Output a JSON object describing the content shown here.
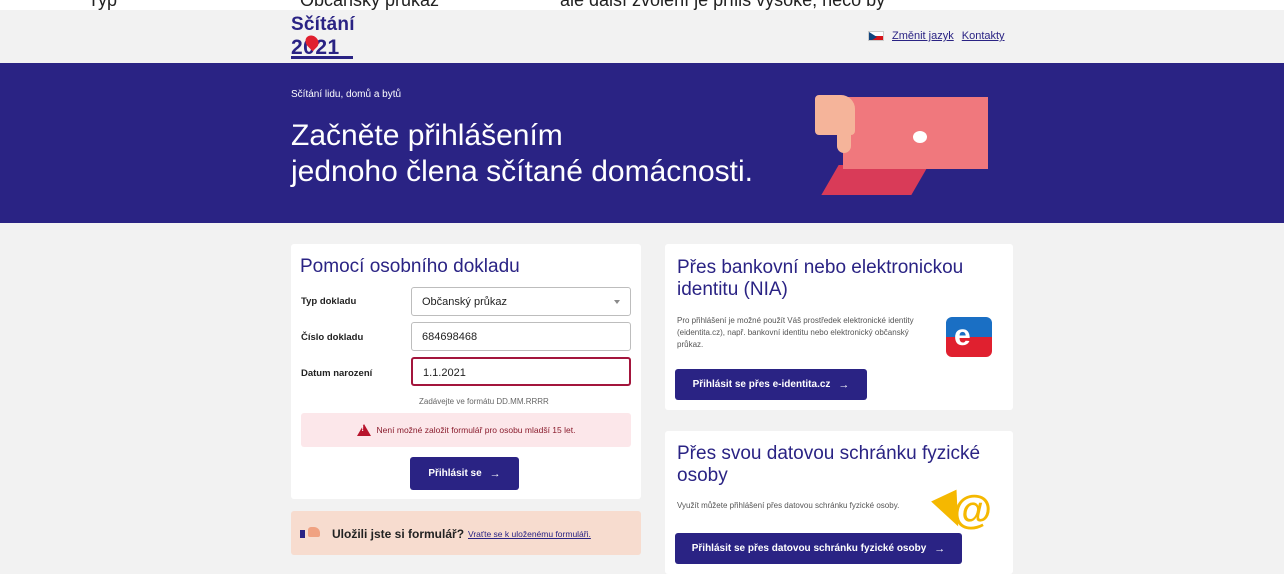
{
  "top_crop": [
    "Typ",
    "Občanský průkaz",
    "ale další zvolení je příliš vysoké, něco by"
  ],
  "logo": {
    "text": "Sčítání",
    "year": "2021"
  },
  "header": {
    "change_language": "Změnit jazyk",
    "contacts": "Kontakty"
  },
  "banner": {
    "subtitle": "Sčítání lidu, domů a bytů",
    "title_line1": "Začněte přihlášením",
    "title_line2": "jednoho člena sčítané domácnosti."
  },
  "form": {
    "title": "Pomocí osobního dokladu",
    "doc_type_label": "Typ dokladu",
    "doc_type_value": "Občanský průkaz",
    "doc_number_label": "Číslo dokladu",
    "doc_number_value": "684698468",
    "birth_date_label": "Datum narození",
    "birth_date_value": "1.1.2021",
    "birth_date_hint": "Zadávejte ve formátu DD.MM.RRRR",
    "error_message": "Není možné založit formulář pro osobu mladší 15 let.",
    "login_button": "Přihlásit se"
  },
  "saved_form": {
    "text": "Uložili jste si formulář?",
    "link": "Vraťte se k uloženému formuláři."
  },
  "nia": {
    "title": "Přes bankovní nebo elektronickou identitu (NIA)",
    "description": "Pro přihlášení je možné použít Váš prostředek elektronické identity (eidentita.cz), např. bankovní identitu nebo elektronický občanský průkaz.",
    "button": "Přihlásit se přes e-identita.cz"
  },
  "data_box": {
    "title": "Přes svou datovou schránku fyzické osoby",
    "description": "Využít můžete přihlášení přes datovou schránku fyzické osoby.",
    "button": "Přihlásit se přes datovou schránku fyzické osoby"
  },
  "arrow": "→",
  "colors": {
    "brand_navy": "#2a2384",
    "error": "#a3153c",
    "accent_red": "#e0202f",
    "accent_yellow": "#f5b800"
  }
}
